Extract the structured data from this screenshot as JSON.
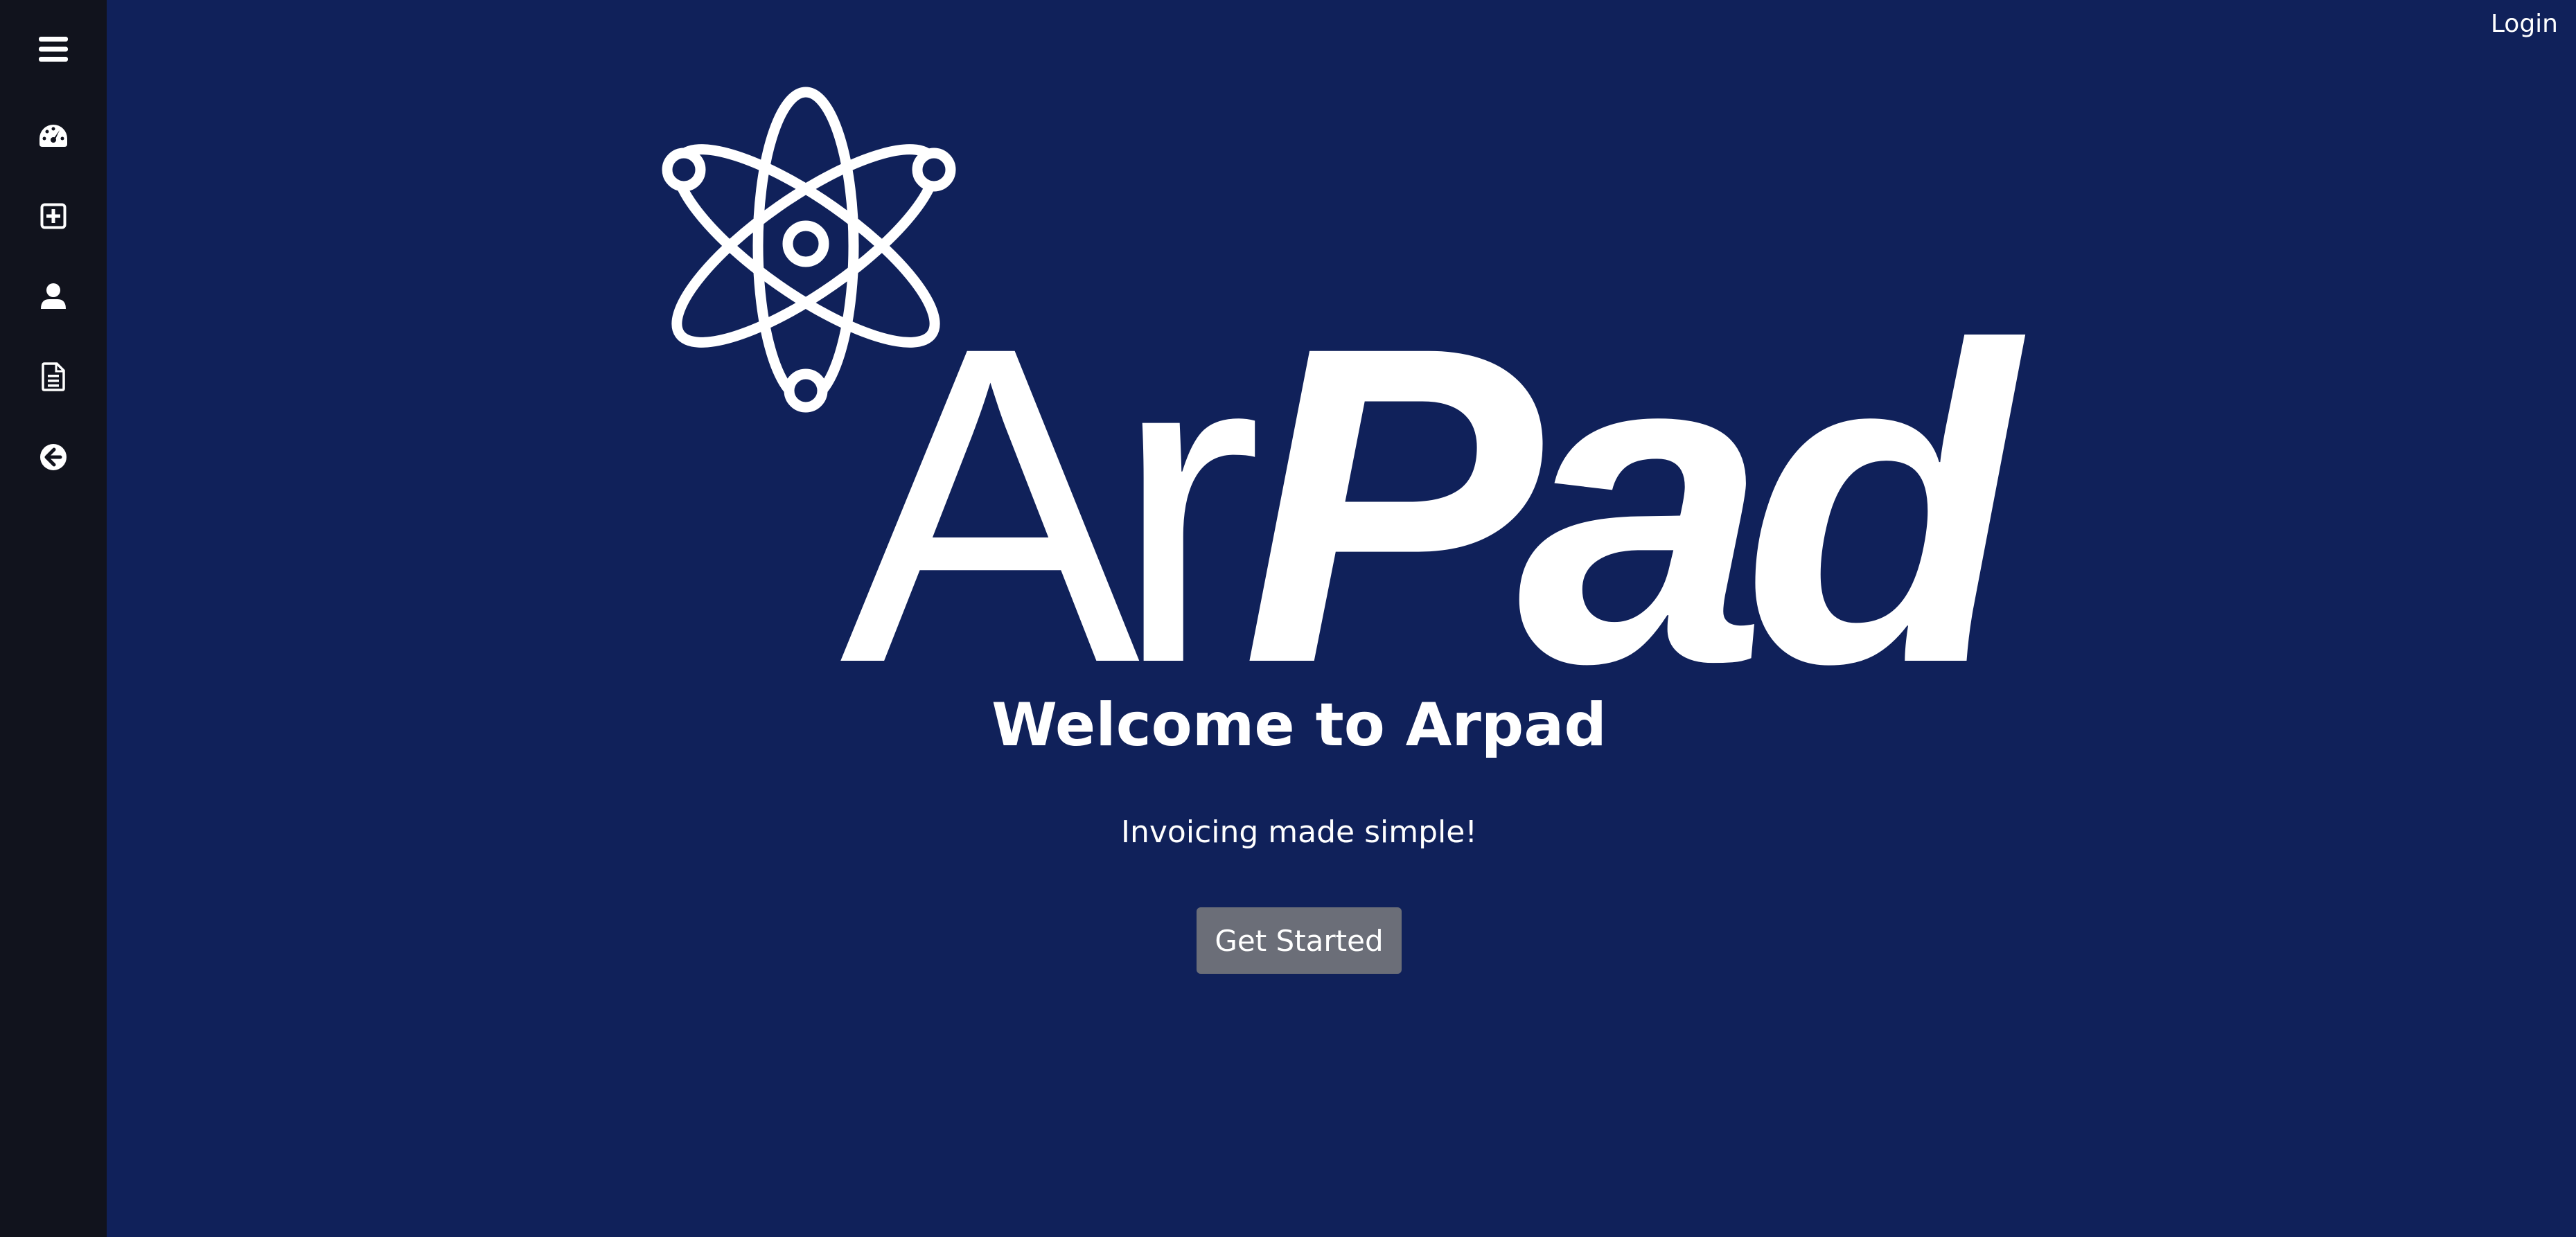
{
  "app": {
    "brand_light": "Ar",
    "brand_bold": "Pad"
  },
  "header": {
    "login_label": "Login"
  },
  "sidebar": {
    "items": [
      {
        "icon": "menu-icon"
      },
      {
        "icon": "dashboard-icon"
      },
      {
        "icon": "add-square-icon"
      },
      {
        "icon": "user-icon"
      },
      {
        "icon": "document-icon"
      },
      {
        "icon": "arrow-left-circle-icon"
      }
    ]
  },
  "hero": {
    "title": "Welcome to Arpad",
    "subtitle": "Invoicing made simple!",
    "cta_label": "Get Started"
  },
  "colors": {
    "background": "#10215a",
    "sidebar": "#11131d",
    "button": "#6b6e78",
    "text": "#ffffff"
  }
}
